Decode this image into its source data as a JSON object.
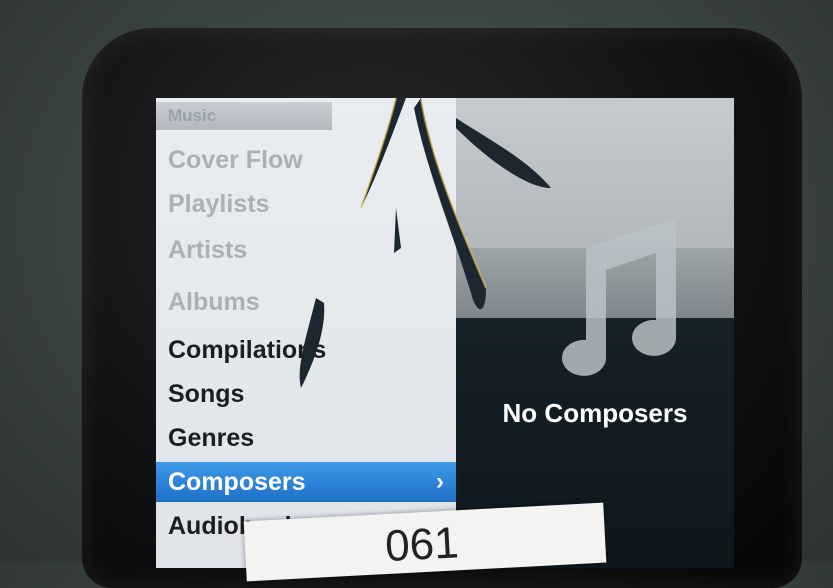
{
  "menu": {
    "title": "Music",
    "items": [
      {
        "label": "Cover Flow",
        "faded": true
      },
      {
        "label": "Playlists",
        "faded": true
      },
      {
        "label": "Artists",
        "faded": true
      },
      {
        "label": "Albums",
        "faded": true
      },
      {
        "label": "Compilations",
        "faded": false
      },
      {
        "label": "Songs",
        "faded": false
      },
      {
        "label": "Genres",
        "faded": false
      },
      {
        "label": "Composers",
        "faded": false,
        "selected": true
      },
      {
        "label": "Audiobooks",
        "faded": false
      }
    ],
    "selected_chevron": "›"
  },
  "panel": {
    "message": "No Composers",
    "icon": "music-note-icon"
  },
  "sticker": {
    "text": "061"
  },
  "colors": {
    "selection": "#1f6fc7",
    "menu_bg": "#e9edf0",
    "panel_bg": "#0e171c"
  }
}
